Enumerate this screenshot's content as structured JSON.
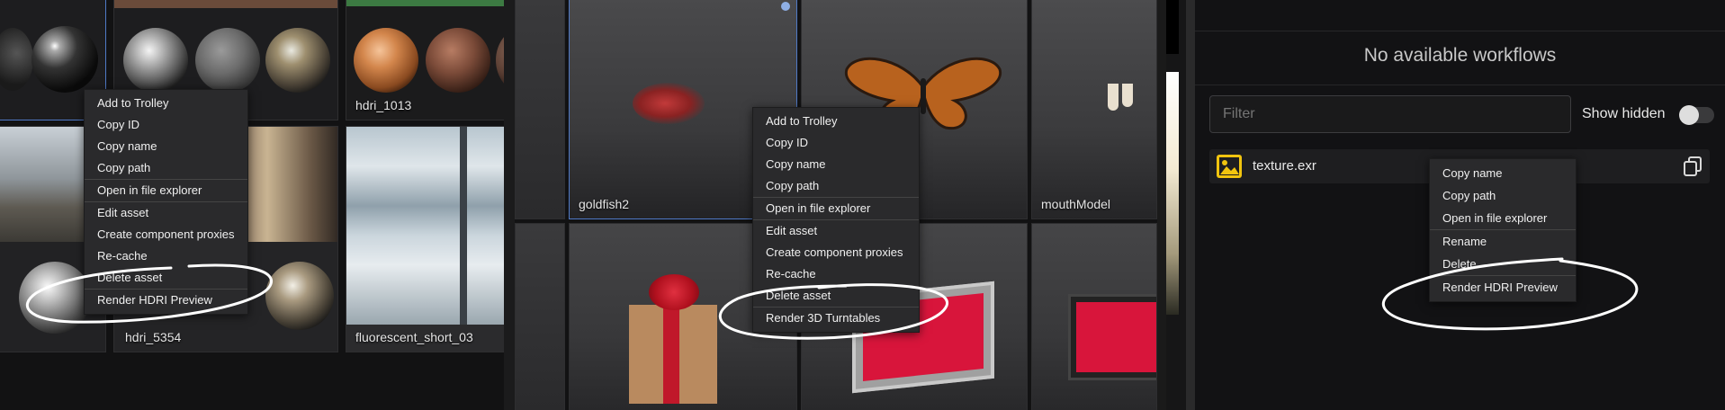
{
  "panel1": {
    "tiles": [
      {
        "label": "hdri_1013"
      },
      {
        "label": "hdri_5354"
      },
      {
        "label": "fluorescent_short_03"
      }
    ],
    "menu_items": [
      "Add to Trolley",
      "Copy ID",
      "Copy name",
      "Copy path",
      "Open in file explorer",
      "Edit asset",
      "Create component proxies",
      "Re-cache",
      "Delete asset",
      "Render HDRI Preview"
    ]
  },
  "panel2": {
    "tiles": [
      {
        "label": "goldfish2"
      },
      {
        "label": "mouthModel"
      }
    ],
    "menu_items": [
      "Add to Trolley",
      "Copy ID",
      "Copy name",
      "Copy path",
      "Open in file explorer",
      "Edit asset",
      "Create component proxies",
      "Re-cache",
      "Delete asset",
      "Render 3D Turntables"
    ]
  },
  "panel3": {
    "title": "No available workflows",
    "filter": {
      "placeholder": "Filter",
      "value": ""
    },
    "toggle": {
      "label": "Show hidden",
      "on": false
    },
    "file": {
      "name": "texture.exr",
      "icon": "image-icon"
    },
    "copy_icon": "copy-icon",
    "menu_items": [
      "Copy name",
      "Copy path",
      "Open in file explorer",
      "Rename",
      "Delete",
      "Render HDRI Preview"
    ]
  },
  "colors": {
    "selection_border": "#4f79c6",
    "menu_bg": "#2a2a2c",
    "scribble": "#ffffff",
    "file_icon": "#f1c40f",
    "monitor_screen": "#d8153b",
    "gift_ribbon": "#c0182a",
    "gift_box": "#b98a5f"
  }
}
